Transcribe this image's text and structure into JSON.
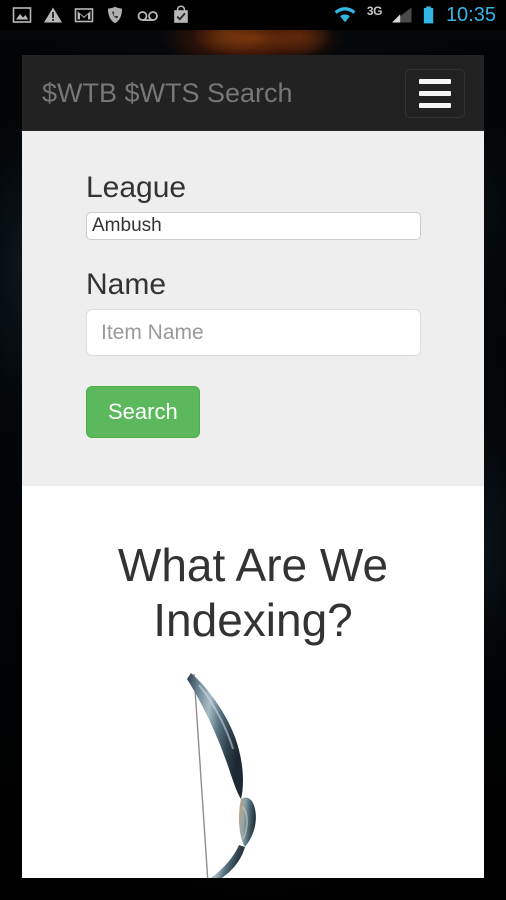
{
  "statusbar": {
    "icons": [
      {
        "name": "gallery-image-icon",
        "glyph": "image"
      },
      {
        "name": "warning-triangle-icon",
        "glyph": "warning"
      },
      {
        "name": "gmail-icon",
        "glyph": "mail"
      },
      {
        "name": "phone-shield-icon",
        "glyph": "shield"
      },
      {
        "name": "voicemail-icon",
        "glyph": "voicemail"
      },
      {
        "name": "shopping-bag-check-icon",
        "glyph": "bag"
      }
    ],
    "network_label": "3G",
    "clock": "10:35",
    "accent_color": "#33b5e5"
  },
  "navbar": {
    "brand": "$WTB $WTS Search",
    "brand_color": "#777777",
    "background_color": "#222222",
    "menu_toggle_name": "navbar-toggle"
  },
  "form": {
    "background_color": "#eeeeee",
    "league": {
      "label": "League",
      "value": "Ambush",
      "options": [
        "Ambush"
      ]
    },
    "name": {
      "label": "Name",
      "value": "",
      "placeholder": "Item Name"
    },
    "submit": {
      "label": "Search",
      "color": "#5cb85c"
    }
  },
  "content": {
    "title": "What Are We Indexing?",
    "illustration": "bow-image"
  }
}
